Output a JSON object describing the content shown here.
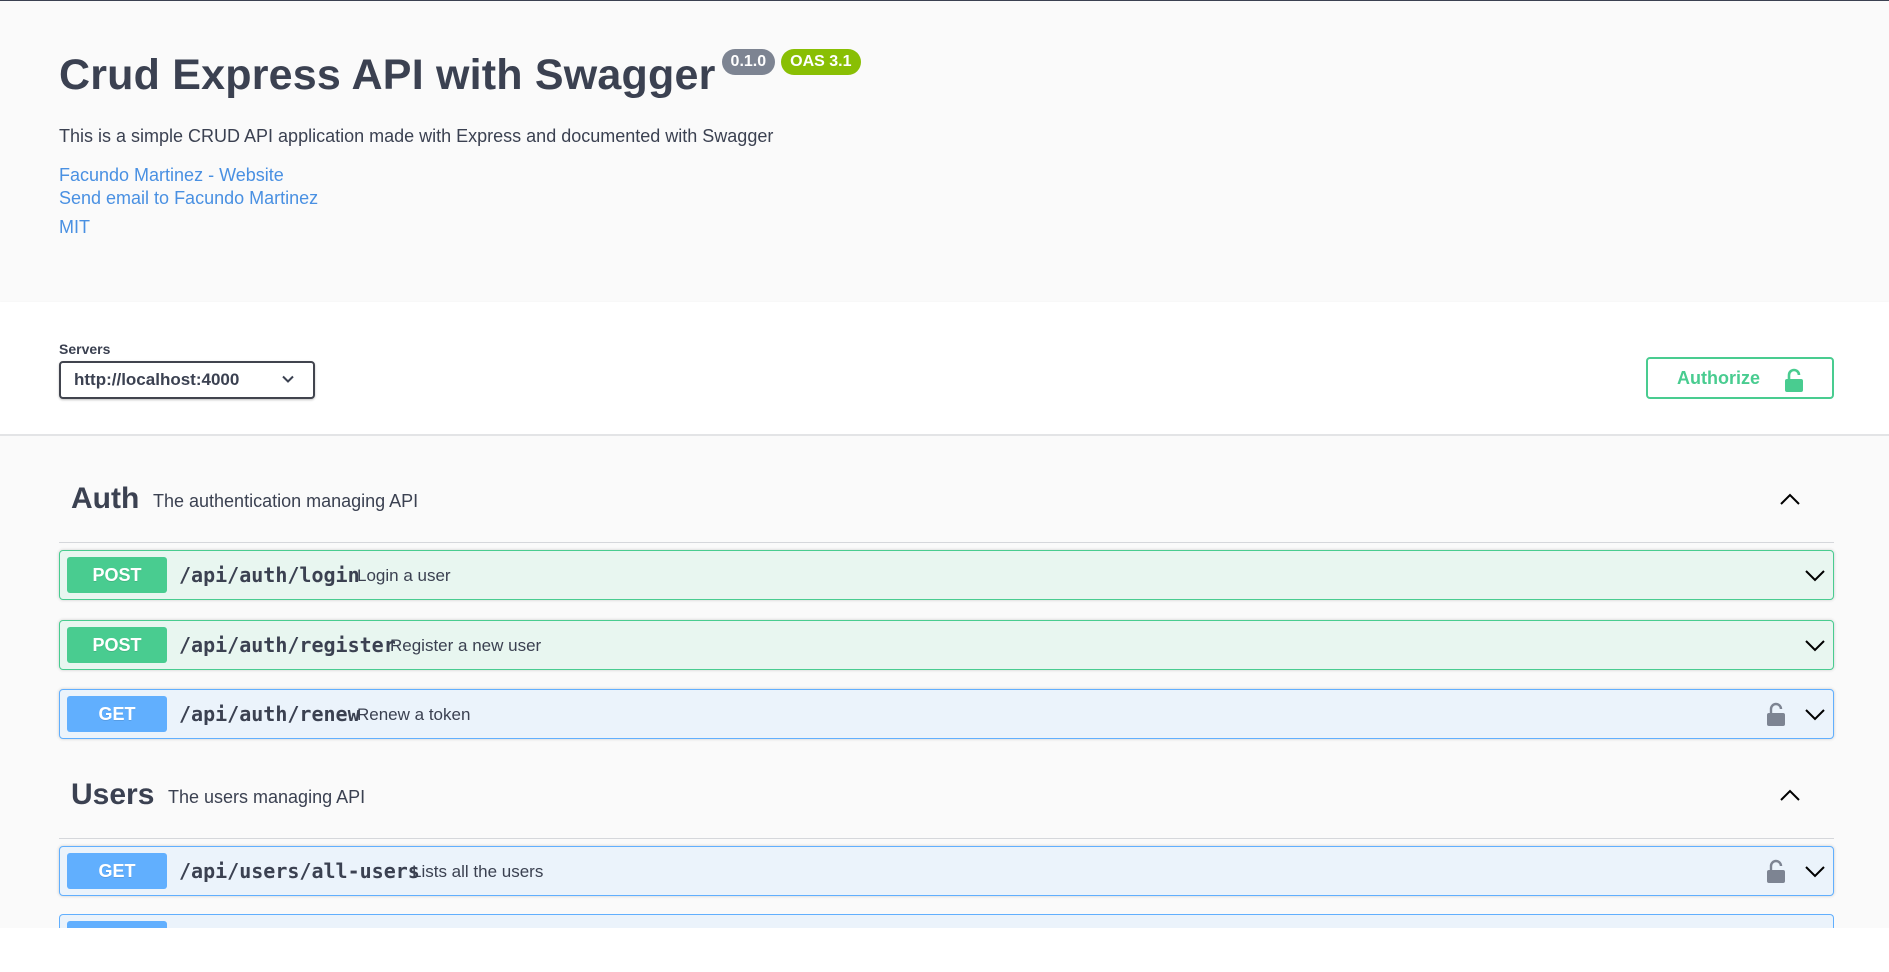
{
  "info": {
    "title": "Crud Express API with Swagger",
    "version_badge": "0.1.0",
    "oas_badge": "OAS 3.1",
    "description": "This is a simple CRUD API application made with Express and documented with Swagger",
    "links": {
      "website": "Facundo Martinez - Website",
      "email": "Send email to Facundo Martinez",
      "license": "MIT"
    }
  },
  "servers": {
    "label": "Servers",
    "selected": "http://localhost:4000"
  },
  "authorize": {
    "label": "Authorize"
  },
  "tags": [
    {
      "name": "Auth",
      "description": "The authentication managing API",
      "operations": [
        {
          "method": "POST",
          "path": "/api/auth/login",
          "summary": "Login a user",
          "locked": false
        },
        {
          "method": "POST",
          "path": "/api/auth/register",
          "summary": "Register a new user",
          "locked": false
        },
        {
          "method": "GET",
          "path": "/api/auth/renew",
          "summary": "Renew a token",
          "locked": true
        }
      ]
    },
    {
      "name": "Users",
      "description": "The users managing API",
      "operations": [
        {
          "method": "GET",
          "path": "/api/users/all-users",
          "summary": "Lists all the users",
          "locked": true
        }
      ]
    }
  ],
  "colors": {
    "post": "#49cc90",
    "get": "#61affe",
    "link": "#4990e2",
    "text": "#3b4151"
  }
}
